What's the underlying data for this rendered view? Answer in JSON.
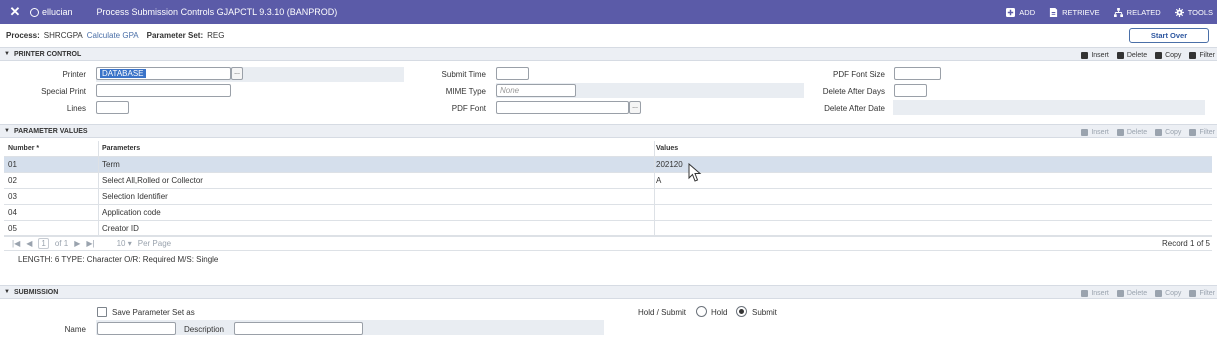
{
  "topbar": {
    "close_glyph": "✕",
    "brand": "ellucian",
    "title": "Process Submission Controls GJAPCTL 9.3.10 (BANPROD)",
    "actions": [
      "ADD",
      "RETRIEVE",
      "RELATED",
      "TOOLS"
    ],
    "bg_color": "#5b5ba8"
  },
  "process": {
    "process_label": "Process:",
    "process_code": "SHRCGPA",
    "process_name": "Calculate GPA",
    "paramset_label": "Parameter Set:",
    "paramset_value": "REG",
    "start_over": "Start Over"
  },
  "printer_control": {
    "section_title": "PRINTER CONTROL",
    "tools": [
      "Insert",
      "Delete",
      "Copy",
      "Filter"
    ],
    "printer_label": "Printer",
    "printer_value": "DATABASE",
    "special_print_label": "Special Print",
    "lines_label": "Lines",
    "submit_time_label": "Submit Time",
    "mime_type_label": "MIME Type",
    "mime_type_placeholder": "None",
    "pdf_font_label": "PDF Font",
    "pdf_font_size_label": "PDF Font Size",
    "delete_after_days_label": "Delete After Days",
    "delete_after_date_label": "Delete After Date",
    "lookup_glyph": "..."
  },
  "parameter_values": {
    "section_title": "PARAMETER VALUES",
    "tools": [
      "Insert",
      "Delete",
      "Copy",
      "Filter"
    ],
    "columns": [
      "Number *",
      "Parameters",
      "Values"
    ],
    "rows": [
      {
        "number": "01",
        "parameter": "Term",
        "value": "202120"
      },
      {
        "number": "02",
        "parameter": "Select All,Rolled or Collector",
        "value": "A"
      },
      {
        "number": "03",
        "parameter": "Selection Identifier",
        "value": ""
      },
      {
        "number": "04",
        "parameter": "Application code",
        "value": ""
      },
      {
        "number": "05",
        "parameter": "Creator ID",
        "value": ""
      }
    ],
    "pager": {
      "page_of": "of 1",
      "page_num": "1",
      "per_page_value": "10",
      "per_page_label": "Per Page",
      "record": "Record 1 of 5"
    },
    "info_text": "LENGTH: 6 TYPE: Character O/R: Required M/S: Single"
  },
  "submission": {
    "section_title": "SUBMISSION",
    "tools": [
      "Insert",
      "Delete",
      "Copy",
      "Filter"
    ],
    "save_label": "Save Parameter Set as",
    "name_label": "Name",
    "description_label": "Description",
    "hold_submit_label": "Hold / Submit",
    "hold_label": "Hold",
    "submit_label": "Submit"
  }
}
